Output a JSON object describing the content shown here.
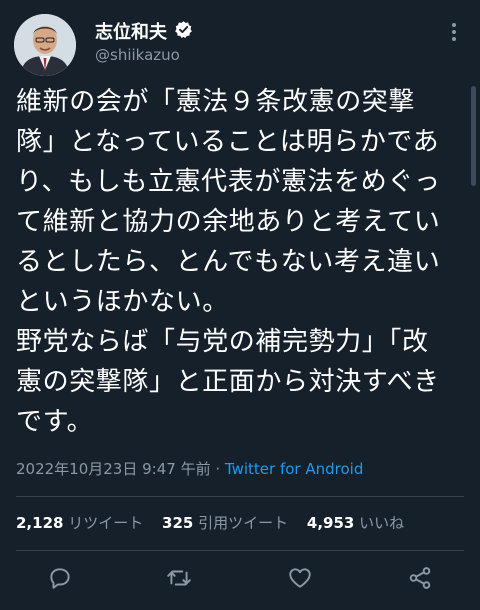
{
  "header": {
    "display_name": "志位和夫",
    "handle": "@shiikazuo"
  },
  "tweet": {
    "lines": [
      "維新の会が「憲法９条改憲の突撃",
      "隊」となっていることは明らかであ",
      "り、もしも立憲代表が憲法をめぐっ",
      "て維新と協力の余地ありと考えてい",
      "るとしたら、とんでもない考え違い",
      "というほかない。",
      "野党ならば「与党の補完勢力」「改",
      "憲の突撃隊」と正面から対決すべき",
      "です。"
    ]
  },
  "meta": {
    "datetime": "2022年10月23日 9:47 午前",
    "separator": "·",
    "source": "Twitter for Android"
  },
  "stats": {
    "retweets_count": "2,128",
    "retweets_label": "リツイート",
    "quotes_count": "325",
    "quotes_label": "引用ツイート",
    "likes_count": "4,953",
    "likes_label": "いいね"
  },
  "actions": {
    "reply_icon": "reply-icon",
    "retweet_icon": "retweet-icon",
    "like_icon": "heart-icon",
    "share_icon": "share-icon"
  },
  "colors": {
    "background": "#15202b",
    "text": "#ffffff",
    "secondary": "#8b98a5",
    "link": "#1d9bf0",
    "divider": "#38444d"
  }
}
